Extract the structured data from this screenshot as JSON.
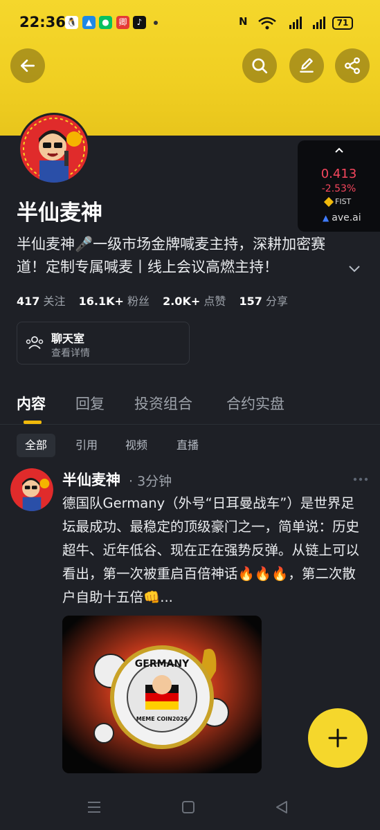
{
  "status_bar": {
    "time": "22:36",
    "icons": [
      "qq-icon",
      "app-icon",
      "wechat-icon",
      "news-icon",
      "tiktok-icon"
    ],
    "right_nfc": "N",
    "right_battery": "71"
  },
  "header": {
    "back_icon": "back-arrow-icon",
    "search_icon": "search-icon",
    "edit_icon": "edit-icon",
    "share_icon": "share-icon"
  },
  "profile": {
    "name": "半仙麦神",
    "bio": "半仙麦神🎤一级市场金牌喊麦主持，深耕加密赛道！定制专属喊麦丨线上会议高燃主持！",
    "stats": {
      "following_count": "417",
      "following_label": "关注",
      "followers_count": "16.1K+",
      "followers_label": "粉丝",
      "likes_count": "2.0K+",
      "likes_label": "点赞",
      "shares_count": "157",
      "shares_label": "分享"
    },
    "chat_room": {
      "title": "聊天室",
      "subtitle": "查看详情"
    }
  },
  "price_widget": {
    "price": "0.413",
    "change": "-2.53%",
    "token": "FIST",
    "source": "ave.ai"
  },
  "tabs": [
    {
      "label": "内容"
    },
    {
      "label": "回复"
    },
    {
      "label": "投资组合"
    },
    {
      "label": "合约实盘"
    }
  ],
  "filters": [
    {
      "label": "全部"
    },
    {
      "label": "引用"
    },
    {
      "label": "视频"
    },
    {
      "label": "直播"
    }
  ],
  "post": {
    "author": "半仙麦神",
    "time": "· 3分钟",
    "text": "德国队Germany（外号“日耳曼战车”）是世界足坛最成功、最稳定的顶级豪门之一，简单说：历史超牛、近年低谷、现在正在强势反弹。从链上可以看出，第一次被重启百倍神话🔥🔥🔥，第二次散户自助十五倍👊...",
    "image_caption": "GERMANY",
    "image_sub": "MEME COIN2026"
  },
  "colors": {
    "accent_yellow": "#f5d72c",
    "background": "#1e2026",
    "negative": "#f6465d"
  }
}
